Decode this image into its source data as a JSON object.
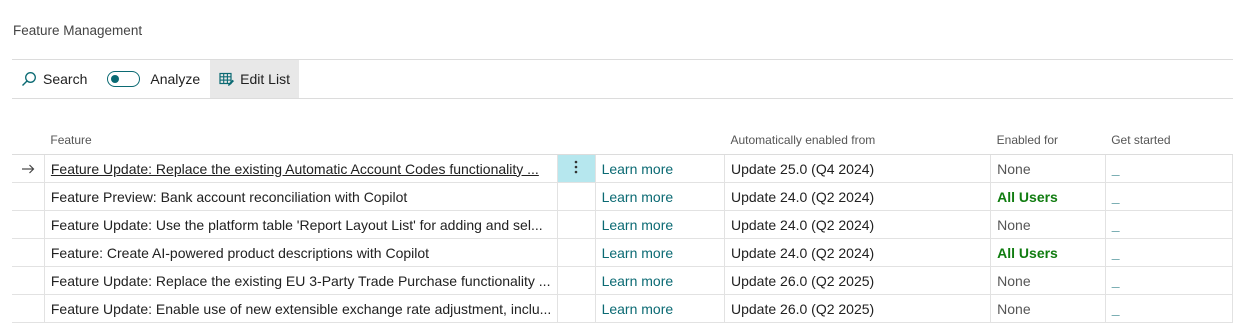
{
  "page": {
    "title": "Feature Management"
  },
  "toolbar": {
    "search_label": "Search",
    "analyze_label": "Analyze",
    "edit_list_label": "Edit List",
    "accent_color": "#0b6a73"
  },
  "table": {
    "headers": {
      "feature": "Feature",
      "auto_enabled": "Automatically enabled from",
      "enabled_for": "Enabled for",
      "get_started": "Get started"
    },
    "rows": [
      {
        "feature": "Feature Update: Replace the existing Automatic Account Codes functionality ...",
        "learn_more": "Learn more",
        "auto_enabled": "Update 25.0 (Q4 2024)",
        "enabled_for": "None",
        "get_started": "_"
      },
      {
        "feature": "Feature Preview: Bank account reconciliation with Copilot",
        "learn_more": "Learn more",
        "auto_enabled": "Update 24.0 (Q2 2024)",
        "enabled_for": "All Users",
        "get_started": "_"
      },
      {
        "feature": "Feature Update: Use the platform table 'Report Layout List' for adding and sel...",
        "learn_more": "Learn more",
        "auto_enabled": "Update 24.0 (Q2 2024)",
        "enabled_for": "None",
        "get_started": "_"
      },
      {
        "feature": "Feature: Create AI-powered product descriptions with Copilot",
        "learn_more": "Learn more",
        "auto_enabled": "Update 24.0 (Q2 2024)",
        "enabled_for": "All Users",
        "get_started": "_"
      },
      {
        "feature": "Feature Update: Replace the existing EU 3-Party Trade Purchase functionality ...",
        "learn_more": "Learn more",
        "auto_enabled": "Update 26.0 (Q2 2025)",
        "enabled_for": "None",
        "get_started": "_"
      },
      {
        "feature": "Feature Update: Enable use of new extensible exchange rate adjustment, inclu...",
        "learn_more": "Learn more",
        "auto_enabled": "Update 26.0 (Q2 2025)",
        "enabled_for": "None",
        "get_started": "_"
      }
    ]
  }
}
